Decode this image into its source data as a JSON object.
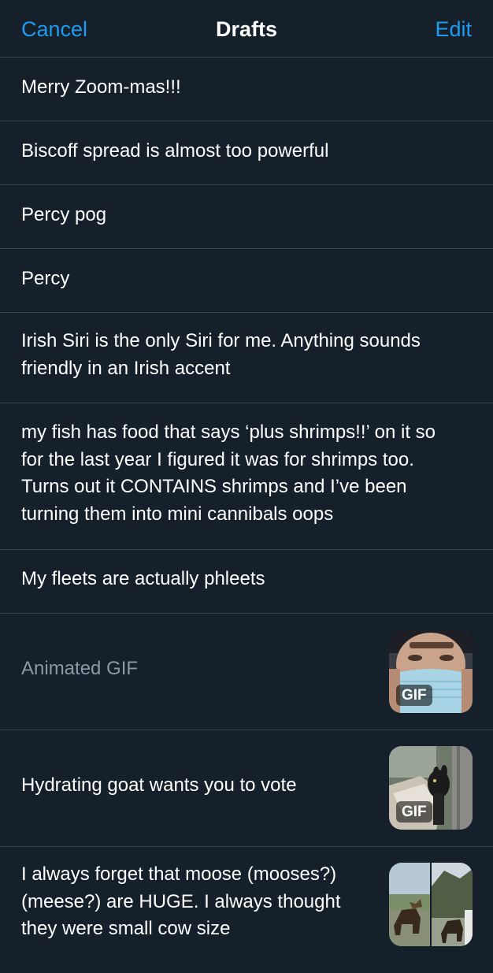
{
  "header": {
    "cancel_label": "Cancel",
    "title": "Drafts",
    "edit_label": "Edit"
  },
  "colors": {
    "background": "#15202b",
    "accent": "#1d9bf0",
    "divider": "#38444d",
    "muted_text": "#8b98a5"
  },
  "drafts": [
    {
      "text": "Merry Zoom-mas!!!"
    },
    {
      "text": "Biscoff spread is almost too powerful"
    },
    {
      "text": "Percy pog"
    },
    {
      "text": "Percy"
    },
    {
      "text": "Irish Siri is the only Siri for me. Anything sounds\nfriendly in an Irish accent"
    },
    {
      "text": "my fish has food that says ‘plus shrimps!!’ on it so\nfor the last year I figured it was for shrimps too.\nTurns out it CONTAINS shrimps and I’ve been\nturning them into mini cannibals oops"
    },
    {
      "text": "My fleets are actually phleets"
    },
    {
      "text": "Animated GIF",
      "badge": "GIF",
      "thumbnail": "masked-man-gif"
    },
    {
      "text": "Hydrating goat wants you to vote",
      "badge": "GIF",
      "thumbnail": "goat-gif"
    },
    {
      "text": "I always forget that moose (mooses?)\n(meese?) are HUGE. I always thought\nthey were small cow size",
      "thumbnail": "moose-photos"
    }
  ]
}
